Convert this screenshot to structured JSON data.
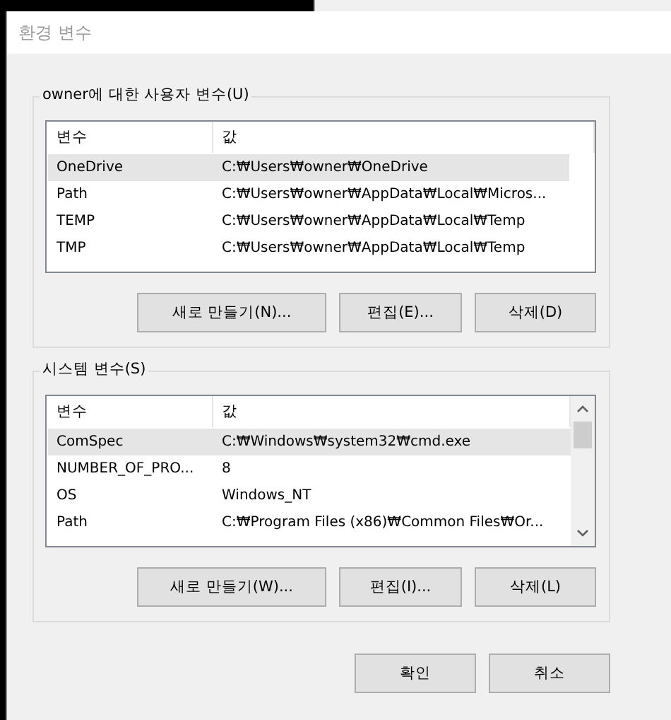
{
  "window": {
    "title": "환경 변수"
  },
  "user_variables": {
    "label": "owner에 대한 사용자 변수(U)",
    "columns": [
      "변수",
      "값"
    ],
    "scrollbar": false,
    "rows": [
      {
        "name": "OneDrive",
        "value": "C:₩Users₩owner₩OneDrive",
        "selected": true
      },
      {
        "name": "Path",
        "value": "C:₩Users₩owner₩AppData₩Local₩Micros...",
        "selected": false
      },
      {
        "name": "TEMP",
        "value": "C:₩Users₩owner₩AppData₩Local₩Temp",
        "selected": false
      },
      {
        "name": "TMP",
        "value": "C:₩Users₩owner₩AppData₩Local₩Temp",
        "selected": false
      }
    ],
    "buttons": [
      "새로 만들기(N)...",
      "편집(E)...",
      "삭제(D)"
    ]
  },
  "system_variables": {
    "label": "시스템 변수(S)",
    "columns": [
      "변수",
      "값"
    ],
    "scrollbar": true,
    "rows": [
      {
        "name": "ComSpec",
        "value": "C:₩Windows₩system32₩cmd.exe",
        "selected": true
      },
      {
        "name": "NUMBER_OF_PRO...",
        "value": "8",
        "selected": false
      },
      {
        "name": "OS",
        "value": "Windows_NT",
        "selected": false
      },
      {
        "name": "Path",
        "value": "C:₩Program Files (x86)₩Common Files₩Or...",
        "selected": false
      }
    ],
    "buttons": [
      "새로 만들기(W)...",
      "편집(I)...",
      "삭제(L)"
    ]
  },
  "buttons": [
    "확인",
    "취소"
  ]
}
